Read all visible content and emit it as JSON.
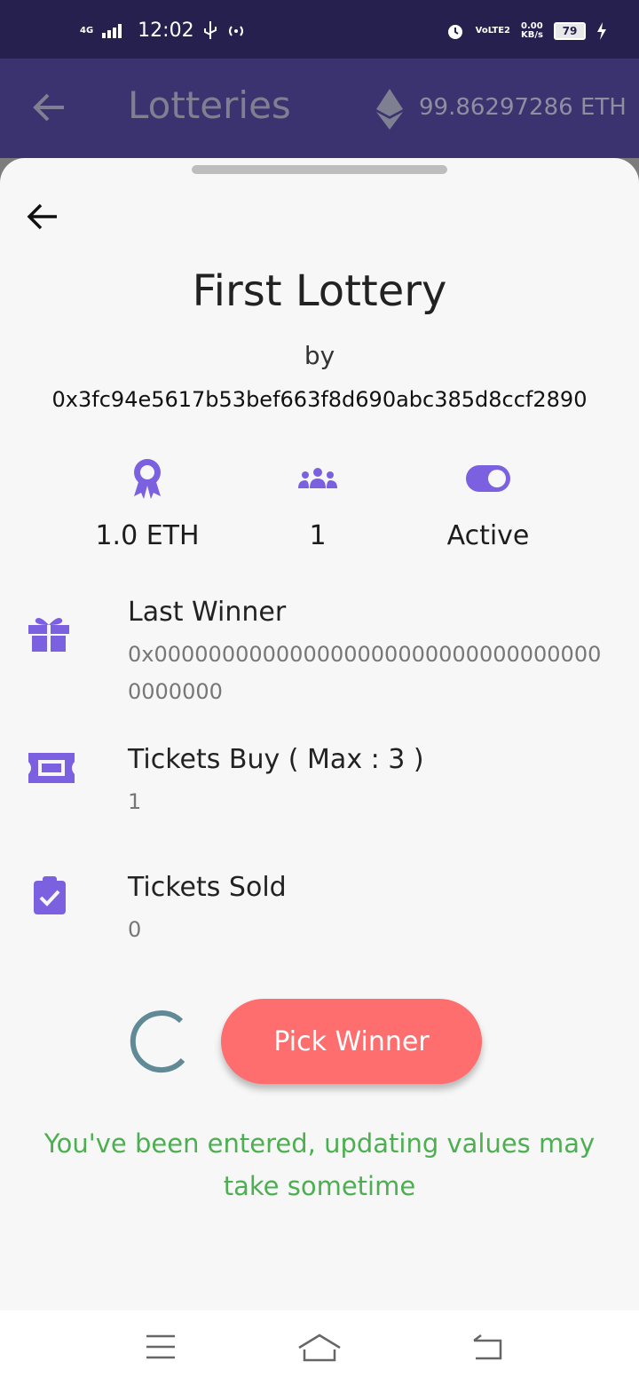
{
  "status_bar": {
    "network": "4G",
    "time": "12:02",
    "volte": "VoLTE2",
    "speed": "0.00",
    "speed_unit": "KB/s",
    "battery": "79",
    "icons": [
      "signal-icon",
      "usb-icon",
      "hotspot-icon",
      "alarm-icon",
      "charging-icon"
    ]
  },
  "app_bar": {
    "title": "Lotteries",
    "balance": "99.86297286 ETH",
    "back_icon": "arrow-left-icon",
    "currency_icon": "ethereum-icon"
  },
  "lottery": {
    "title": "First Lottery",
    "by_label": "by",
    "owner": "0x3fc94e5617b53bef663f8d690abc385d8ccf2890",
    "stats": {
      "prize": "1.0 ETH",
      "players": "1",
      "status": "Active"
    },
    "last_winner": {
      "label": "Last Winner",
      "value": "0x0000000000000000000000000000000000000000"
    },
    "tickets_buy": {
      "label": "Tickets Buy ( Max : 3 )",
      "value": "1"
    },
    "tickets_sold": {
      "label": "Tickets Sold",
      "value": "0"
    },
    "pick_winner_label": "Pick Winner",
    "notice": "You've been entered, updating values may take sometime"
  },
  "colors": {
    "accent": "#7b61e0",
    "status_bar": "#25204d",
    "app_bar": "#3b3370",
    "button": "#ff6e6e",
    "notice": "#4caf50",
    "spinner": "#5f8a96"
  }
}
